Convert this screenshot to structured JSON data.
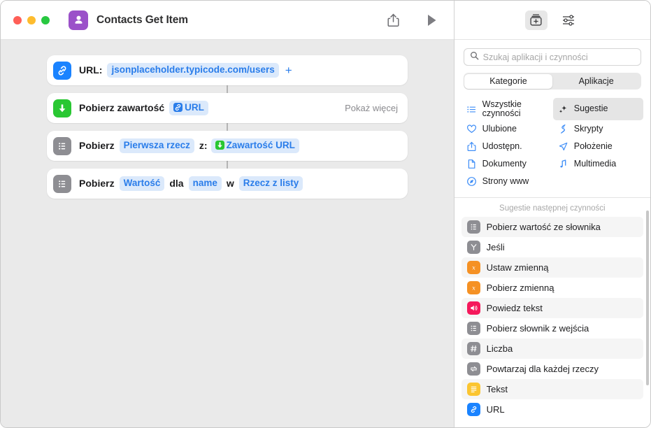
{
  "window": {
    "traffic_lights": [
      "close",
      "minimize",
      "zoom"
    ],
    "app_icon": "contacts-person-icon",
    "title": "Contacts Get Item",
    "toolbar": {
      "share_label": "share-icon",
      "run_label": "play-icon"
    }
  },
  "flow": {
    "actions": [
      {
        "icon": "url-link-icon",
        "icon_color": "#1a83ff",
        "label": "URL:",
        "value": "jsonplaceholder.typicode.com/users",
        "add_button": "+"
      },
      {
        "icon": "download-arrow-icon",
        "icon_color": "#29c732",
        "label": "Pobierz zawartość",
        "token": "URL",
        "token_icon": "url-link-icon",
        "trailing": "Pokaż więcej"
      },
      {
        "icon": "list-icon",
        "icon_color": "#8e8e93",
        "label": "Pobierz",
        "token1": "Pierwsza rzecz",
        "mid": "z:",
        "token2": "Zawartość URL",
        "token2_icon": "download-arrow-icon"
      },
      {
        "icon": "list-icon",
        "icon_color": "#8e8e93",
        "label": "Pobierz",
        "token1": "Wartość",
        "mid1": "dla",
        "token2": "name",
        "mid2": "w",
        "token3": "Rzecz z listy"
      }
    ]
  },
  "library": {
    "tools": [
      {
        "name": "action-library-icon",
        "selected": true
      },
      {
        "name": "sliders-settings-icon",
        "selected": false
      }
    ],
    "search": {
      "placeholder": "Szukaj aplikacji i czynności",
      "value": "",
      "icon": "search-icon"
    },
    "segmented": {
      "options": [
        "Kategorie",
        "Aplikacje"
      ],
      "selected": "Kategorie"
    },
    "categories": [
      {
        "label": "Wszystkie czynności",
        "icon": "list-bullet-icon",
        "selected": false
      },
      {
        "label": "Sugestie",
        "icon": "sparkles-icon",
        "selected": true
      },
      {
        "label": "Ulubione",
        "icon": "heart-icon",
        "selected": false
      },
      {
        "label": "Skrypty",
        "icon": "script-icon",
        "selected": false
      },
      {
        "label": "Udostępn.",
        "icon": "share-icon",
        "selected": false
      },
      {
        "label": "Położenie",
        "icon": "location-arrow-icon",
        "selected": false
      },
      {
        "label": "Dokumenty",
        "icon": "document-icon",
        "selected": false
      },
      {
        "label": "Multimedia",
        "icon": "music-note-icon",
        "selected": false
      },
      {
        "label": "Strony www",
        "icon": "safari-compass-icon",
        "selected": false
      }
    ],
    "suggestions_header": "Sugestie następnej czynności",
    "suggestions": [
      {
        "label": "Pobierz wartość ze słownika",
        "icon": "list-icon",
        "icon_color": "#8e8e93"
      },
      {
        "label": "Jeśli",
        "icon": "if-branch-icon",
        "icon_color": "#8e8e93"
      },
      {
        "label": "Ustaw zmienną",
        "icon": "variable-x-icon",
        "icon_color": "#f59124"
      },
      {
        "label": "Pobierz zmienną",
        "icon": "variable-x-icon",
        "icon_color": "#f59124"
      },
      {
        "label": "Powiedz tekst",
        "icon": "speaker-icon",
        "icon_color": "#f5195c"
      },
      {
        "label": "Pobierz słownik z wejścia",
        "icon": "list-icon",
        "icon_color": "#8e8e93"
      },
      {
        "label": "Liczba",
        "icon": "hash-number-icon",
        "icon_color": "#8e8e93"
      },
      {
        "label": "Powtarzaj dla każdej rzeczy",
        "icon": "repeat-icon",
        "icon_color": "#8e8e93"
      },
      {
        "label": "Tekst",
        "icon": "text-lines-icon",
        "icon_color": "#fbc531"
      },
      {
        "label": "URL",
        "icon": "url-link-icon",
        "icon_color": "#1a83ff"
      }
    ]
  }
}
